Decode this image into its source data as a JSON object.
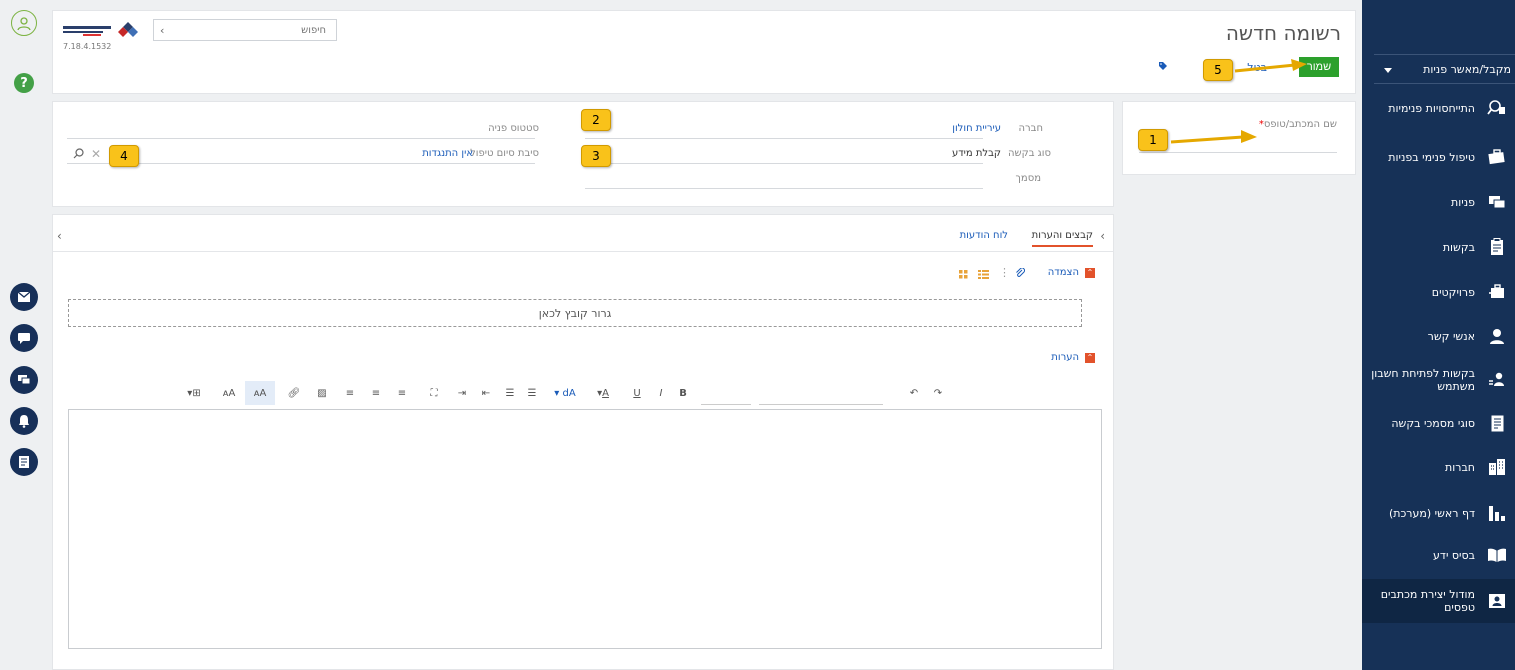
{
  "sidebar": {
    "dropdown_label": "מקבל/מאשר פניות",
    "items": [
      {
        "label": "התייחסויות פנימיות",
        "icon": "search-person-icon"
      },
      {
        "label": "טיפול פנימי בפניות",
        "icon": "briefcase-icon"
      },
      {
        "label": "פניות",
        "icon": "chat-icon"
      },
      {
        "label": "בקשות",
        "icon": "clipboard-icon"
      },
      {
        "label": "פרויקטים",
        "icon": "briefcase-tool-icon"
      },
      {
        "label": "אנשי קשר",
        "icon": "person-icon"
      },
      {
        "label": "בקשות לפתיחת חשבון משתמש",
        "icon": "user-list-icon"
      },
      {
        "label": "סוגי מסמכי בקשה",
        "icon": "document-icon"
      },
      {
        "label": "חברות",
        "icon": "building-icon"
      },
      {
        "label": "דף ראשי (מערכת)",
        "icon": "bar-chart-icon"
      },
      {
        "label": "בסיס ידע",
        "icon": "book-icon"
      },
      {
        "label": "מודול יצירת מכתבים טפסים",
        "icon": "contact-card-icon"
      }
    ]
  },
  "header": {
    "title": "רשומה חדשה",
    "save_label": "שמור",
    "cancel_label": "בטל",
    "search_placeholder": "חיפוש",
    "version": "7.18.4.1532"
  },
  "template": {
    "label": "שם המכתב/טופס",
    "required_mark": "*"
  },
  "fields": {
    "company_label": "חברה",
    "company_value": "עיריית חולון",
    "request_type_label": "סוג בקשה",
    "request_type_value": "קבלת מידע",
    "document_label": "מסמך",
    "status_label": "סטטוס פניה",
    "end_reason_label": "סיבת סיום טיפול",
    "end_reason_value": "אין התנגדות"
  },
  "tabs": {
    "files": "קבצים והערות",
    "board": "לוח הודעות"
  },
  "sections": {
    "attachment": "הצמדה",
    "dropzone": "גרור קובץ לכאן",
    "notes": "הערות"
  },
  "callouts": [
    "1",
    "2",
    "3",
    "4",
    "5"
  ],
  "colors": {
    "sidebar": "#163157",
    "accent": "#e2522b",
    "save": "#2ca02c",
    "link": "#1a5bb8",
    "callout": "#f9c21a"
  }
}
